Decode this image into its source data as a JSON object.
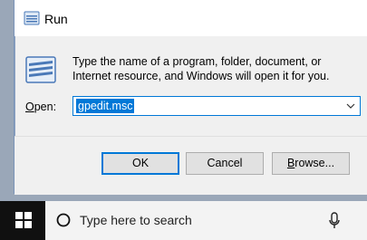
{
  "window": {
    "title": "Run",
    "description": "Type the name of a program, folder, document, or Internet resource, and Windows will open it for you.",
    "open_label_prefix": "",
    "open_label_underlined": "O",
    "open_label_rest": "pen:",
    "open_value": "gpedit.msc",
    "icons": {
      "title": "run-icon",
      "body": "run-icon",
      "dropdown": "chevron-down-icon"
    }
  },
  "buttons": {
    "ok": "OK",
    "cancel": "Cancel",
    "browse_underlined": "B",
    "browse_rest": "rowse..."
  },
  "taskbar": {
    "search_placeholder": "Type here to search",
    "icons": {
      "start": "windows-start-icon",
      "search": "search-circle-icon",
      "mic": "microphone-icon"
    }
  },
  "colors": {
    "accent": "#0078d7",
    "taskbar": "#101010",
    "dialog": "#f0f0f0"
  }
}
